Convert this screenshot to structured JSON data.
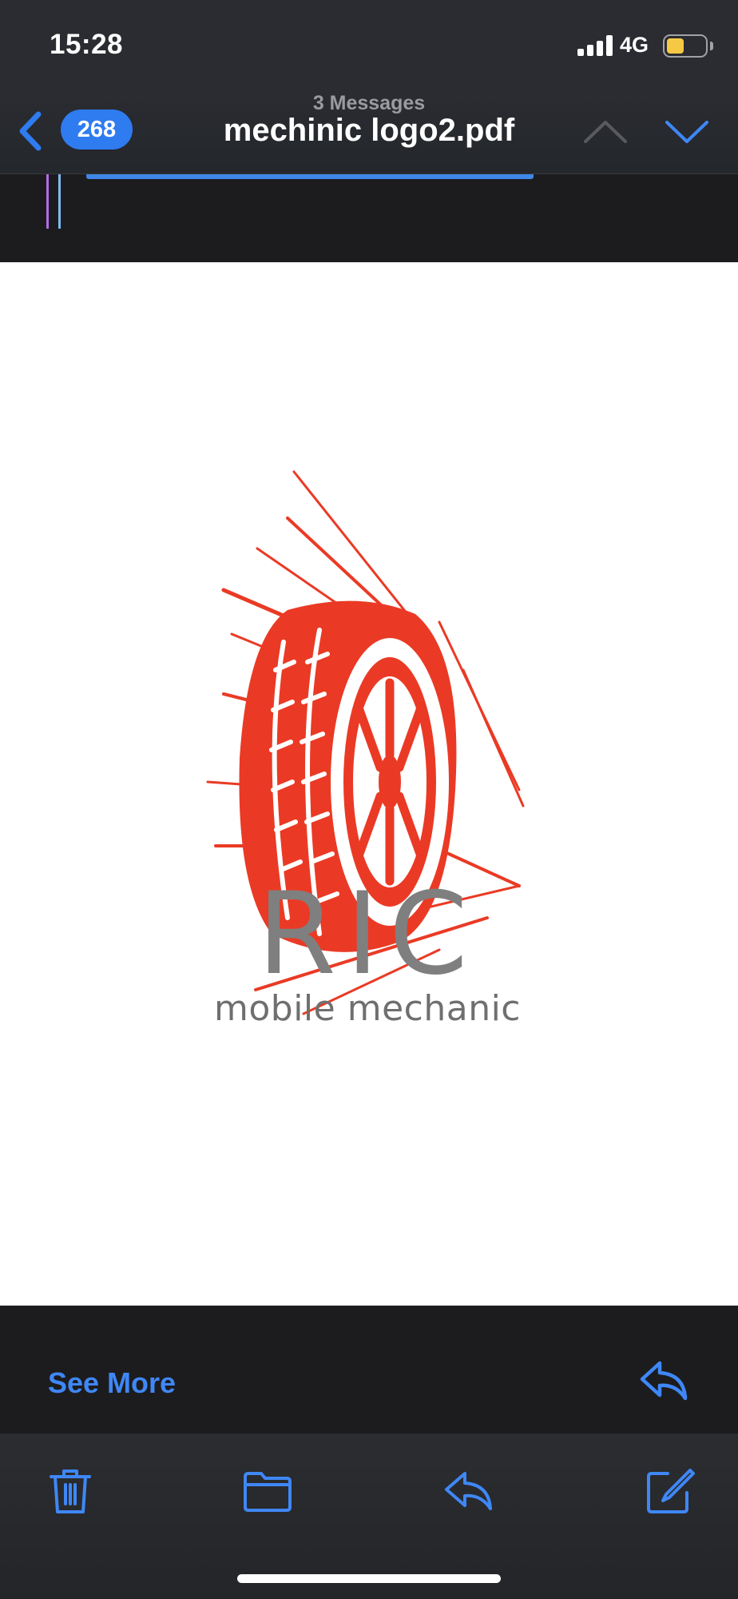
{
  "status_bar": {
    "time": "15:28",
    "network": "4G",
    "battery_level": 0.46,
    "battery_color": "#f6c944",
    "icons": [
      "signal-icon",
      "battery-icon"
    ]
  },
  "header": {
    "back_icon": "chevron-left-icon",
    "unread_count": "268",
    "subtitle": "3 Messages",
    "title": "mechinic logo2.pdf",
    "prev_icon": "chevron-up-icon",
    "next_icon": "chevron-down-icon",
    "accent": "#2f7bf0"
  },
  "attachment": {
    "logo": {
      "title": "RIC",
      "subtitle": "mobile mechanic",
      "tire_color": "#ea3a25",
      "text_color": "#7f7f7f"
    }
  },
  "footer_card": {
    "see_more_label": "See More",
    "reply_icon": "reply-icon"
  },
  "toolbar": {
    "items": [
      {
        "name": "trash-icon"
      },
      {
        "name": "folder-icon"
      },
      {
        "name": "reply-icon"
      },
      {
        "name": "compose-icon"
      }
    ],
    "accent": "#3f87f5"
  }
}
